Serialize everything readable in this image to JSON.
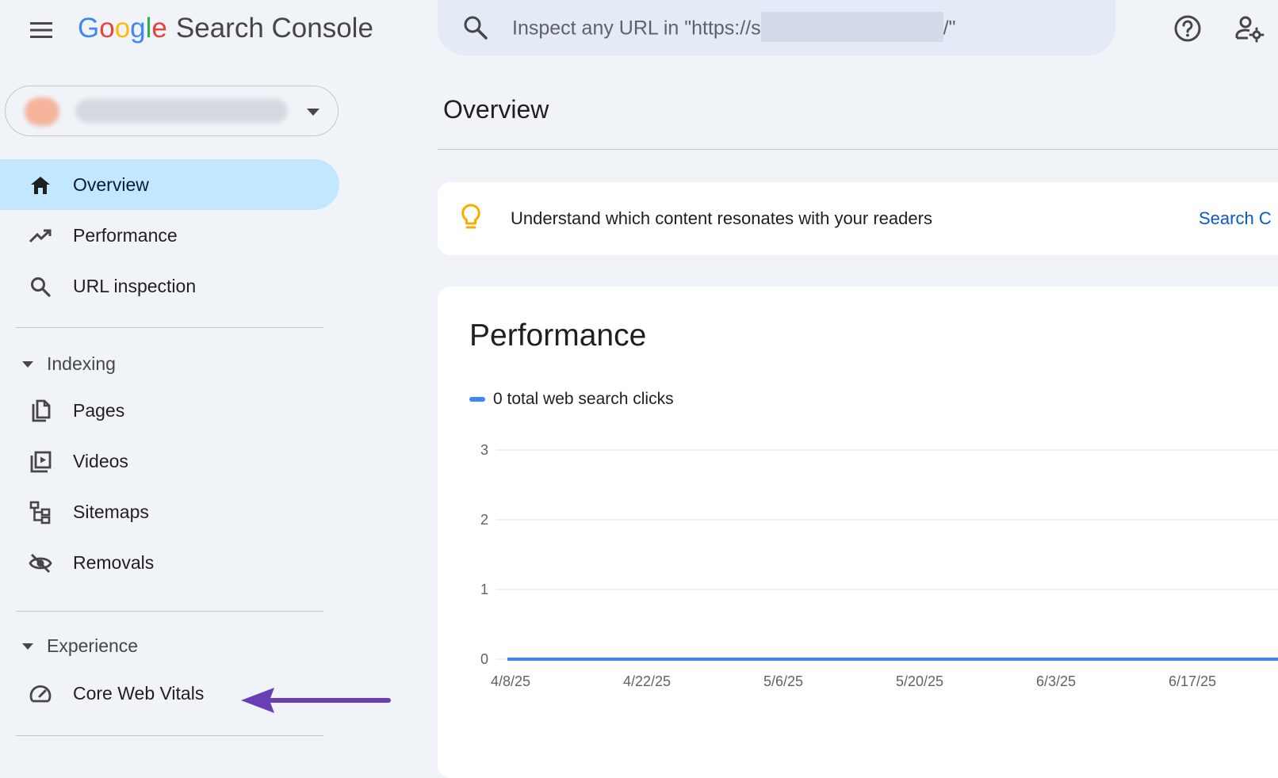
{
  "header": {
    "logo_google": [
      "G",
      "o",
      "o",
      "g",
      "l",
      "e"
    ],
    "logo_google_colors": [
      "#4285f4",
      "#ea4335",
      "#fbbc05",
      "#4285f4",
      "#34a853",
      "#ea4335"
    ],
    "product_name": "Search Console",
    "search_placeholder_prefix": "Inspect any URL in \"https://s",
    "search_placeholder_suffix": "/\"",
    "icons": {
      "menu": "menu-icon",
      "search": "search-icon",
      "help": "help-icon",
      "admin": "manage-accounts-icon"
    }
  },
  "sidebar": {
    "items": [
      {
        "label": "Overview",
        "icon": "home-icon",
        "active": true
      },
      {
        "label": "Performance",
        "icon": "trending-up-icon"
      },
      {
        "label": "URL inspection",
        "icon": "search-icon"
      }
    ],
    "sections": [
      {
        "label": "Indexing",
        "items": [
          {
            "label": "Pages",
            "icon": "pages-icon"
          },
          {
            "label": "Videos",
            "icon": "video-library-icon"
          },
          {
            "label": "Sitemaps",
            "icon": "sitemap-icon"
          },
          {
            "label": "Removals",
            "icon": "visibility-off-icon"
          }
        ]
      },
      {
        "label": "Experience",
        "items": [
          {
            "label": "Core Web Vitals",
            "icon": "speed-icon"
          }
        ]
      }
    ]
  },
  "main": {
    "title": "Overview",
    "tip": {
      "message": "Understand which content resonates with your readers",
      "link": "Search C"
    },
    "performance": {
      "title": "Performance",
      "legend": "0 total web search clicks"
    }
  },
  "colors": {
    "accent": "#0b57d0",
    "active_nav": "#c2e7ff",
    "series": "#4285f4",
    "annotation": "#6a3fb5",
    "background": "#f0f4f9"
  },
  "chart_data": {
    "type": "line",
    "title": "",
    "xlabel": "",
    "ylabel": "",
    "ylim": [
      0,
      3
    ],
    "yticks": [
      0,
      1,
      2,
      3
    ],
    "x": [
      "4/8/25",
      "4/22/25",
      "5/6/25",
      "5/20/25",
      "6/3/25",
      "6/17/25"
    ],
    "series": [
      {
        "name": "0 total web search clicks",
        "values": [
          0,
          0,
          0,
          0,
          0,
          0
        ]
      }
    ],
    "grid": true
  }
}
